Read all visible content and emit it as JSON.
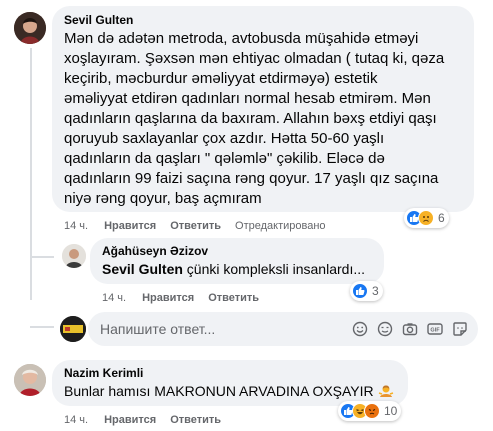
{
  "comments": [
    {
      "author": "Sevil Gulten",
      "lines": [
        "Mən də adətən metroda, avtobusda müşahidə etməyi",
        "xoşlayıram. Şəxsən mən ehtiyac olmadan ( tutaq ki, qəza",
        "keçirib, məcburdur əməliyyat etdirməyə) estetik",
        "əməliyyat etdirən qadınları normal hesab etmirəm. Mən",
        "qadınların qaşlarına da baxıram. Allahın bəxş etdiyi qaşı",
        "qoruyub saxlayanlar çox azdır. Hətta 50-60 yaşlı",
        "qadınların da qaşları \" qələmlə\" çəkilib. Eləcə də",
        "qadınların 99 faizi saçına rəng qoyur. 17 yaşlı qız saçına",
        "niyə rəng qoyur, baş açmıram"
      ],
      "time": "14 ч.",
      "like": "Нравится",
      "reply": "Ответить",
      "extra": "Отредактировано",
      "reaction_count": "6"
    },
    {
      "author": "Ağahüseyn Əzizov",
      "mention": "Sevil Gulten",
      "text": " çünki kompleksli insanlardı...",
      "time": "14 ч.",
      "like": "Нравится",
      "reply": "Ответить",
      "reaction_count": "3"
    },
    {
      "author": "Nazim Kerimli",
      "text": "Bunlar hamısı MAKRONUN ARVADINA OXŞAYIR",
      "time": "14 ч.",
      "like": "Нравится",
      "reply": "Ответить",
      "reaction_count": "10"
    }
  ],
  "composer": {
    "placeholder": "Напишите ответ...",
    "icons": [
      "emoji-icon",
      "sticker-face-icon",
      "camera-icon",
      "gif-icon",
      "sticker-icon"
    ]
  },
  "colors": {
    "bubble": "#f0f2f5",
    "like_blue": "#1877f2",
    "haha_yellow": "#f7b125",
    "meta_gray": "#65676b"
  }
}
